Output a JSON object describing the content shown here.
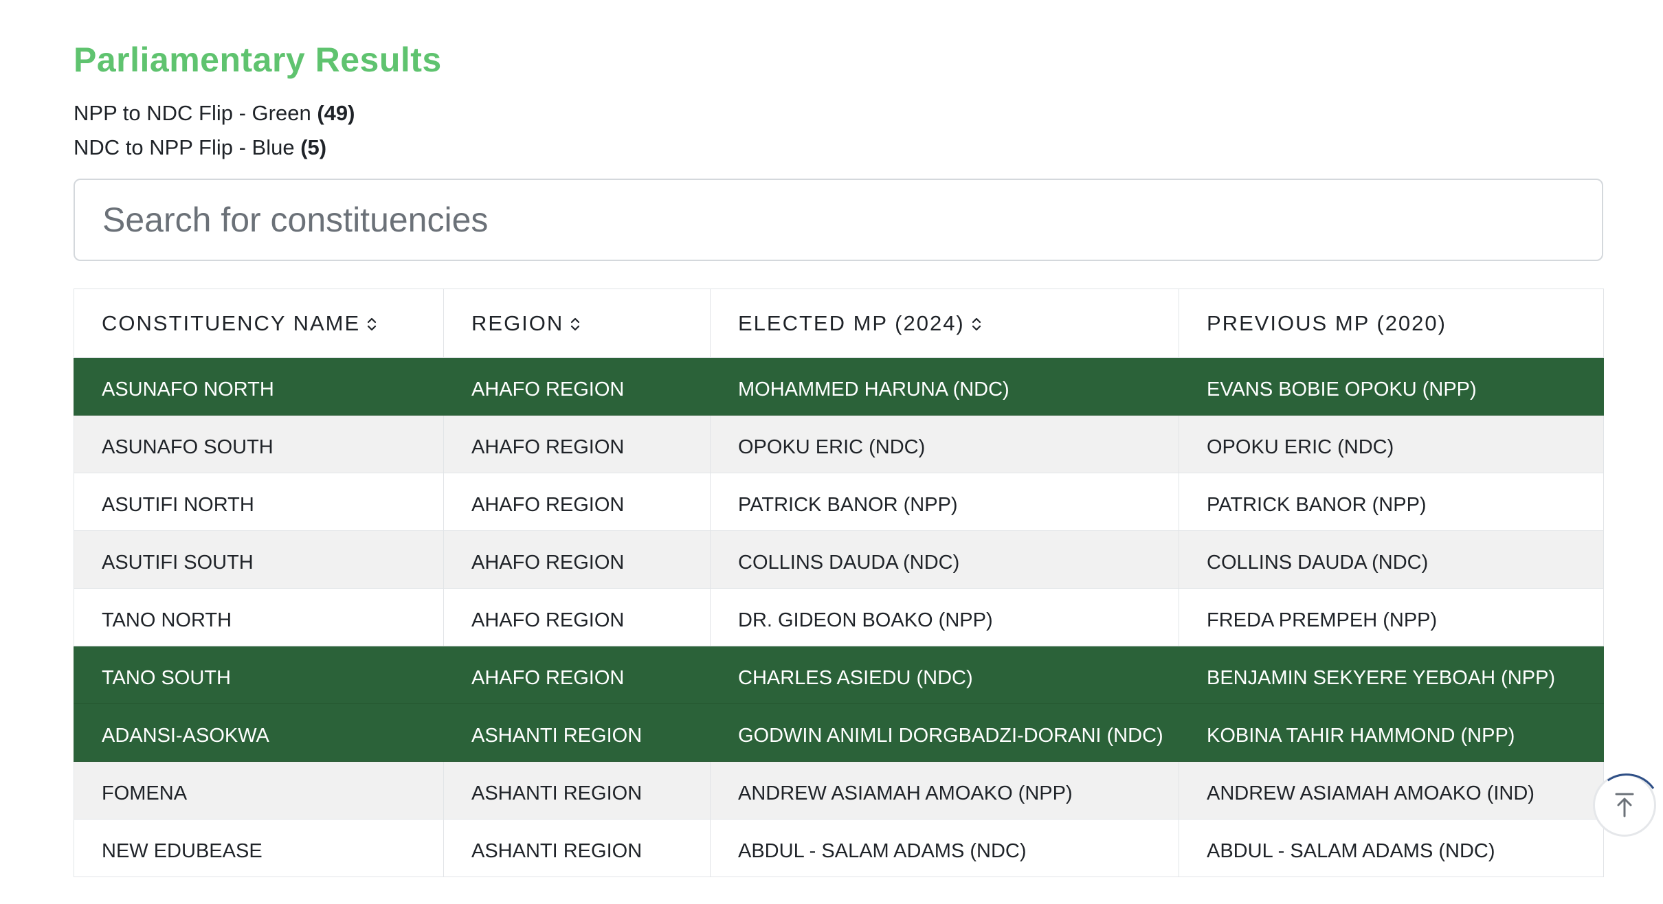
{
  "page": {
    "title": "Parliamentary Results",
    "legend": {
      "green_label": "NPP to NDC Flip - Green",
      "green_count": "(49)",
      "blue_label": "NDC to NPP Flip - Blue",
      "blue_count": "(5)"
    },
    "search": {
      "placeholder": "Search for constituencies",
      "value": ""
    }
  },
  "colors": {
    "title_green": "#5fc36f",
    "flip_row_green": "#2b6239",
    "row_alt_grey": "#f1f1f1"
  },
  "table": {
    "headers": {
      "constituency": "CONSTITUENCY NAME",
      "region": "REGION",
      "elected": "ELECTED MP (2024)",
      "previous": "PREVIOUS MP (2020)"
    },
    "rows": [
      {
        "name": "ASUNAFO NORTH",
        "region": "AHAFO REGION",
        "elected": "MOHAMMED HARUNA (NDC)",
        "previous": "EVANS BOBIE OPOKU (NPP)",
        "highlight": "green"
      },
      {
        "name": "ASUNAFO SOUTH",
        "region": "AHAFO REGION",
        "elected": "OPOKU ERIC (NDC)",
        "previous": "OPOKU ERIC (NDC)",
        "highlight": "none"
      },
      {
        "name": "ASUTIFI NORTH",
        "region": "AHAFO REGION",
        "elected": "PATRICK BANOR (NPP)",
        "previous": "PATRICK BANOR (NPP)",
        "highlight": "none"
      },
      {
        "name": "ASUTIFI SOUTH",
        "region": "AHAFO REGION",
        "elected": "COLLINS DAUDA (NDC)",
        "previous": "COLLINS DAUDA (NDC)",
        "highlight": "none"
      },
      {
        "name": "TANO NORTH",
        "region": "AHAFO REGION",
        "elected": "DR. GIDEON BOAKO (NPP)",
        "previous": "FREDA PREMPEH (NPP)",
        "highlight": "none"
      },
      {
        "name": "TANO SOUTH",
        "region": "AHAFO REGION",
        "elected": "CHARLES ASIEDU (NDC)",
        "previous": "BENJAMIN SEKYERE YEBOAH (NPP)",
        "highlight": "green"
      },
      {
        "name": "ADANSI-ASOKWA",
        "region": "ASHANTI REGION",
        "elected": "GODWIN ANIMLI DORGBADZI-DORANI (NDC)",
        "previous": "KOBINA TAHIR HAMMOND (NPP)",
        "highlight": "green"
      },
      {
        "name": "FOMENA",
        "region": "ASHANTI REGION",
        "elected": "ANDREW ASIAMAH AMOAKO (NPP)",
        "previous": "ANDREW ASIAMAH AMOAKO (IND)",
        "highlight": "none"
      },
      {
        "name": "NEW EDUBEASE",
        "region": "ASHANTI REGION",
        "elected": "ABDUL - SALAM ADAMS (NDC)",
        "previous": "ABDUL - SALAM ADAMS (NDC)",
        "highlight": "none"
      }
    ]
  },
  "icons": {
    "sort": "sort-updown-icon",
    "scroll_top": "arrow-up-to-top-icon"
  }
}
